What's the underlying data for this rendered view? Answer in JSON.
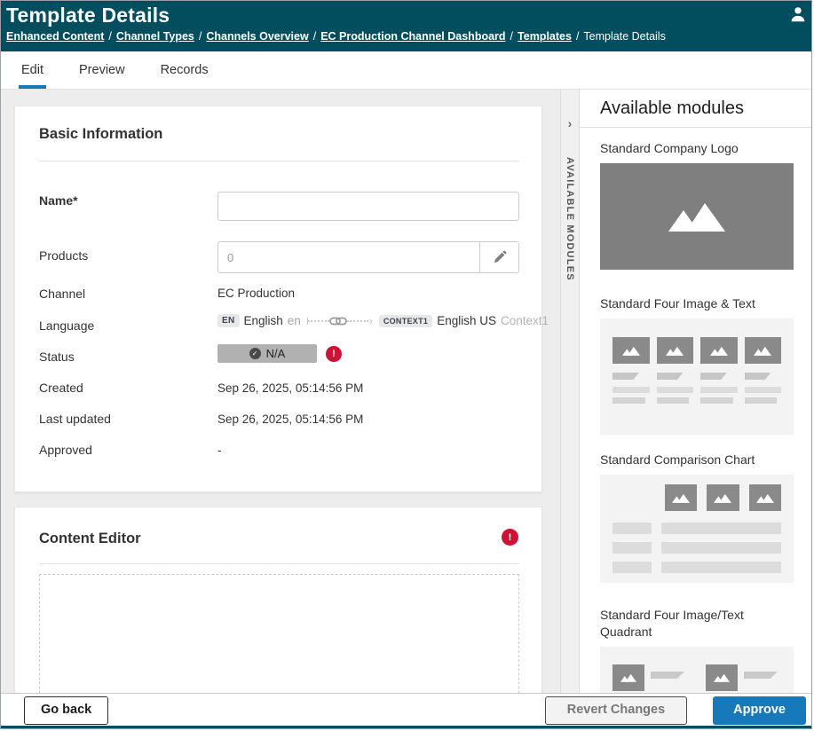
{
  "header": {
    "title": "Template Details",
    "breadcrumb_separator": "/",
    "breadcrumbs": [
      {
        "label": "Enhanced Content"
      },
      {
        "label": "Channel Types"
      },
      {
        "label": "Channels Overview"
      },
      {
        "label": "EC Production Channel Dashboard"
      },
      {
        "label": "Templates"
      },
      {
        "label": "Template Details"
      }
    ]
  },
  "tabs": [
    {
      "label": "Edit"
    },
    {
      "label": "Preview"
    },
    {
      "label": "Records"
    }
  ],
  "basic": {
    "title": "Basic Information",
    "name_label": "Name*",
    "name_value": "",
    "products_label": "Products",
    "products_value": "0",
    "channel_label": "Channel",
    "channel_value": "EC Production",
    "language_label": "Language",
    "language": {
      "source_badge": "EN",
      "source_name": "English",
      "source_code": "en",
      "target_badge": "CONTEXT1",
      "target_name": "English US",
      "target_context": "Context1"
    },
    "status_label": "Status",
    "status_value": "N/A",
    "status_check": "✓",
    "error_mark": "!",
    "created_label": "Created",
    "created_value": "Sep 26, 2025, 05:14:56 PM",
    "updated_label": "Last updated",
    "updated_value": "Sep 26, 2025, 05:14:56 PM",
    "approved_label": "Approved",
    "approved_value": "-"
  },
  "editor": {
    "title": "Content Editor",
    "error_mark": "!"
  },
  "modules_panel": {
    "strip_label": "AVAILABLE MODULES",
    "strip_chevron": "›",
    "title": "Available modules",
    "items": [
      {
        "name": "Standard Company Logo"
      },
      {
        "name": "Standard Four Image & Text"
      },
      {
        "name": "Standard Comparison Chart"
      },
      {
        "name": "Standard Four Image/Text Quadrant"
      }
    ]
  },
  "footer": {
    "go_back": "Go back",
    "revert": "Revert Changes",
    "approve": "Approve"
  },
  "colors": {
    "header_bg": "#034e5e",
    "accent_blue": "#1779ba",
    "error_red": "#ce1134",
    "page_bg": "#ededed"
  }
}
